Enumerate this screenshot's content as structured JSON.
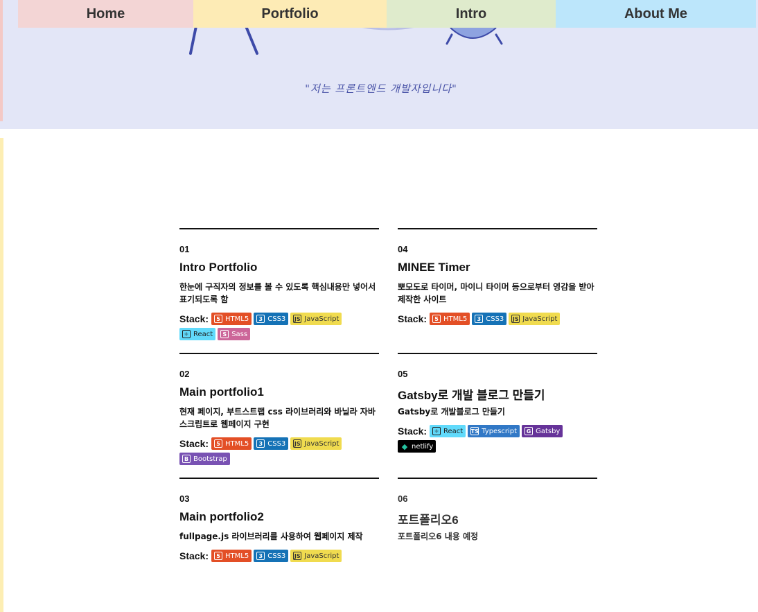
{
  "nav": {
    "items": [
      {
        "label": "Home"
      },
      {
        "label": "Portfolio"
      },
      {
        "label": "Intro"
      },
      {
        "label": "About Me"
      }
    ]
  },
  "hero": {
    "tagline": "\"저는 프론트엔드 개발자입니다\""
  },
  "colors": {
    "html5": "#e34f26",
    "css3": "#1572b6",
    "javascript": "#f0db4f",
    "react": "#61dafb",
    "sass": "#cc6699",
    "bootstrap": "#7952b3",
    "typescript": "#3178c6",
    "gatsby": "#663399",
    "netlify": "#000000"
  },
  "stack_label": "Stack:",
  "portfolio": [
    {
      "num": "01",
      "title": "Intro Portfolio",
      "desc": "한눈에 구직자의 정보를 볼 수 있도록 핵심내용만 넣어서 표기되도록 함",
      "stack": [
        {
          "label": "HTML5",
          "icon": "html5-icon"
        },
        {
          "label": "CSS3",
          "icon": "css3-icon"
        },
        {
          "label": "JavaScript",
          "icon": "javascript-icon"
        },
        {
          "label": "React",
          "icon": "react-icon"
        },
        {
          "label": "Sass",
          "icon": "sass-icon"
        }
      ]
    },
    {
      "num": "02",
      "title": "Main portfolio1",
      "desc": "현재 페이지, 부트스트랩 css 라이브러리와 바닐라 자바스크립트로 웹페이지 구현",
      "stack": [
        {
          "label": "HTML5",
          "icon": "html5-icon"
        },
        {
          "label": "CSS3",
          "icon": "css3-icon"
        },
        {
          "label": "JavaScript",
          "icon": "javascript-icon"
        },
        {
          "label": "Bootstrap",
          "icon": "bootstrap-icon"
        }
      ]
    },
    {
      "num": "03",
      "title": "Main portfolio2",
      "desc": "fullpage.js 라이브러리를 사용하여 웹페이지 제작",
      "stack": [
        {
          "label": "HTML5",
          "icon": "html5-icon"
        },
        {
          "label": "CSS3",
          "icon": "css3-icon"
        },
        {
          "label": "JavaScript",
          "icon": "javascript-icon"
        }
      ]
    },
    {
      "num": "04",
      "title": "MINEE Timer",
      "desc": "뽀모도로 타이머, 마이니 타이머 등으로부터 영감을 받아 제작한 사이트",
      "stack": [
        {
          "label": "HTML5",
          "icon": "html5-icon"
        },
        {
          "label": "CSS3",
          "icon": "css3-icon"
        },
        {
          "label": "JavaScript",
          "icon": "javascript-icon"
        }
      ]
    },
    {
      "num": "05",
      "title": "Gatsby로 개발 블로그 만들기",
      "desc": "Gatsby로 개발블로그 만들기",
      "stack": [
        {
          "label": "React",
          "icon": "react-icon"
        },
        {
          "label": "Typescript",
          "icon": "typescript-icon"
        },
        {
          "label": "Gatsby",
          "icon": "gatsby-icon"
        },
        {
          "label": "netlify",
          "icon": "netlify-icon"
        }
      ]
    },
    {
      "num": "06",
      "title": "포트폴리오6",
      "desc": "포트폴리오6 내용 예정",
      "stack": []
    }
  ]
}
